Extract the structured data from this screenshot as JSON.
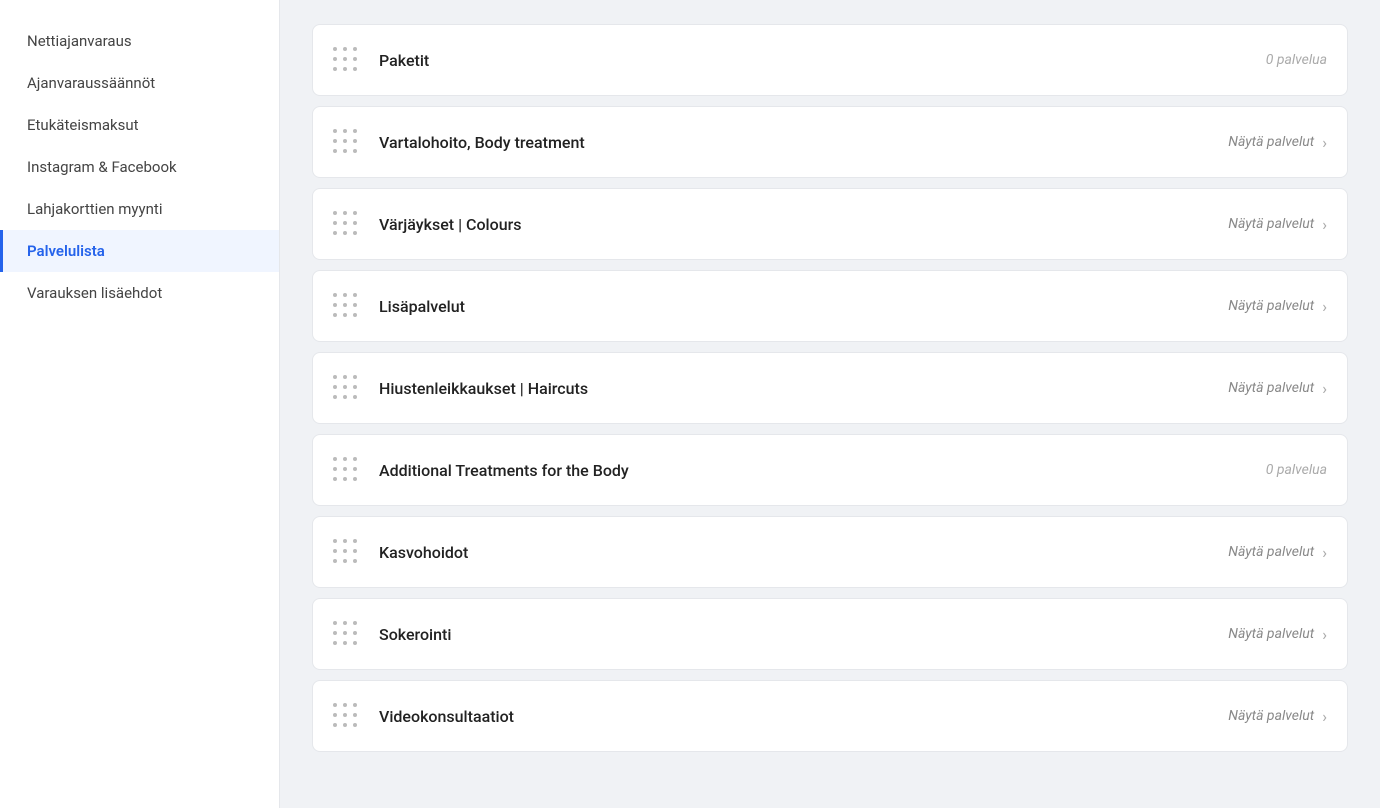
{
  "sidebar": {
    "items": [
      {
        "id": "nettiajanvaraus",
        "label": "Nettiajanvaraus",
        "active": false
      },
      {
        "id": "ajanvaraussaannot",
        "label": "Ajanvaraussäännöt",
        "active": false
      },
      {
        "id": "etukateismaksut",
        "label": "Etukäteismaksut",
        "active": false
      },
      {
        "id": "instagram-facebook",
        "label": "Instagram & Facebook",
        "active": false
      },
      {
        "id": "lahjakorttien-myynti",
        "label": "Lahjakorttien myynti",
        "active": false
      },
      {
        "id": "palvelulista",
        "label": "Palvelulista",
        "active": true
      },
      {
        "id": "varauksen-lisaehdot",
        "label": "Varauksen lisäehdot",
        "active": false
      }
    ]
  },
  "services": [
    {
      "id": "paketit",
      "name": "Paketit",
      "meta_type": "zero",
      "meta_text": "0 palvelua"
    },
    {
      "id": "vartalohoito",
      "name": "Vartalohoito, Body treatment",
      "meta_type": "nayta",
      "meta_text": "Näytä palvelut"
    },
    {
      "id": "varjaykset",
      "name": "Värjäykset | Colours",
      "meta_type": "nayta",
      "meta_text": "Näytä palvelut"
    },
    {
      "id": "lisapalvelut",
      "name": "Lisäpalvelut",
      "meta_type": "nayta",
      "meta_text": "Näytä palvelut"
    },
    {
      "id": "hiustenleikkaukset",
      "name": "Hiustenleikkaukset | Haircuts",
      "meta_type": "nayta",
      "meta_text": "Näytä palvelut"
    },
    {
      "id": "additional-treatments",
      "name": "Additional Treatments for the Body",
      "meta_type": "zero",
      "meta_text": "0 palvelua"
    },
    {
      "id": "kasvohoidot",
      "name": "Kasvohoidot",
      "meta_type": "nayta",
      "meta_text": "Näytä palvelut"
    },
    {
      "id": "sokerointi",
      "name": "Sokerointi",
      "meta_type": "nayta",
      "meta_text": "Näytä palvelut"
    },
    {
      "id": "videokonsultaatiot",
      "name": "Videokonsultaatiot",
      "meta_type": "nayta",
      "meta_text": "Näytä palvelut"
    }
  ],
  "icons": {
    "chevron": "›"
  }
}
